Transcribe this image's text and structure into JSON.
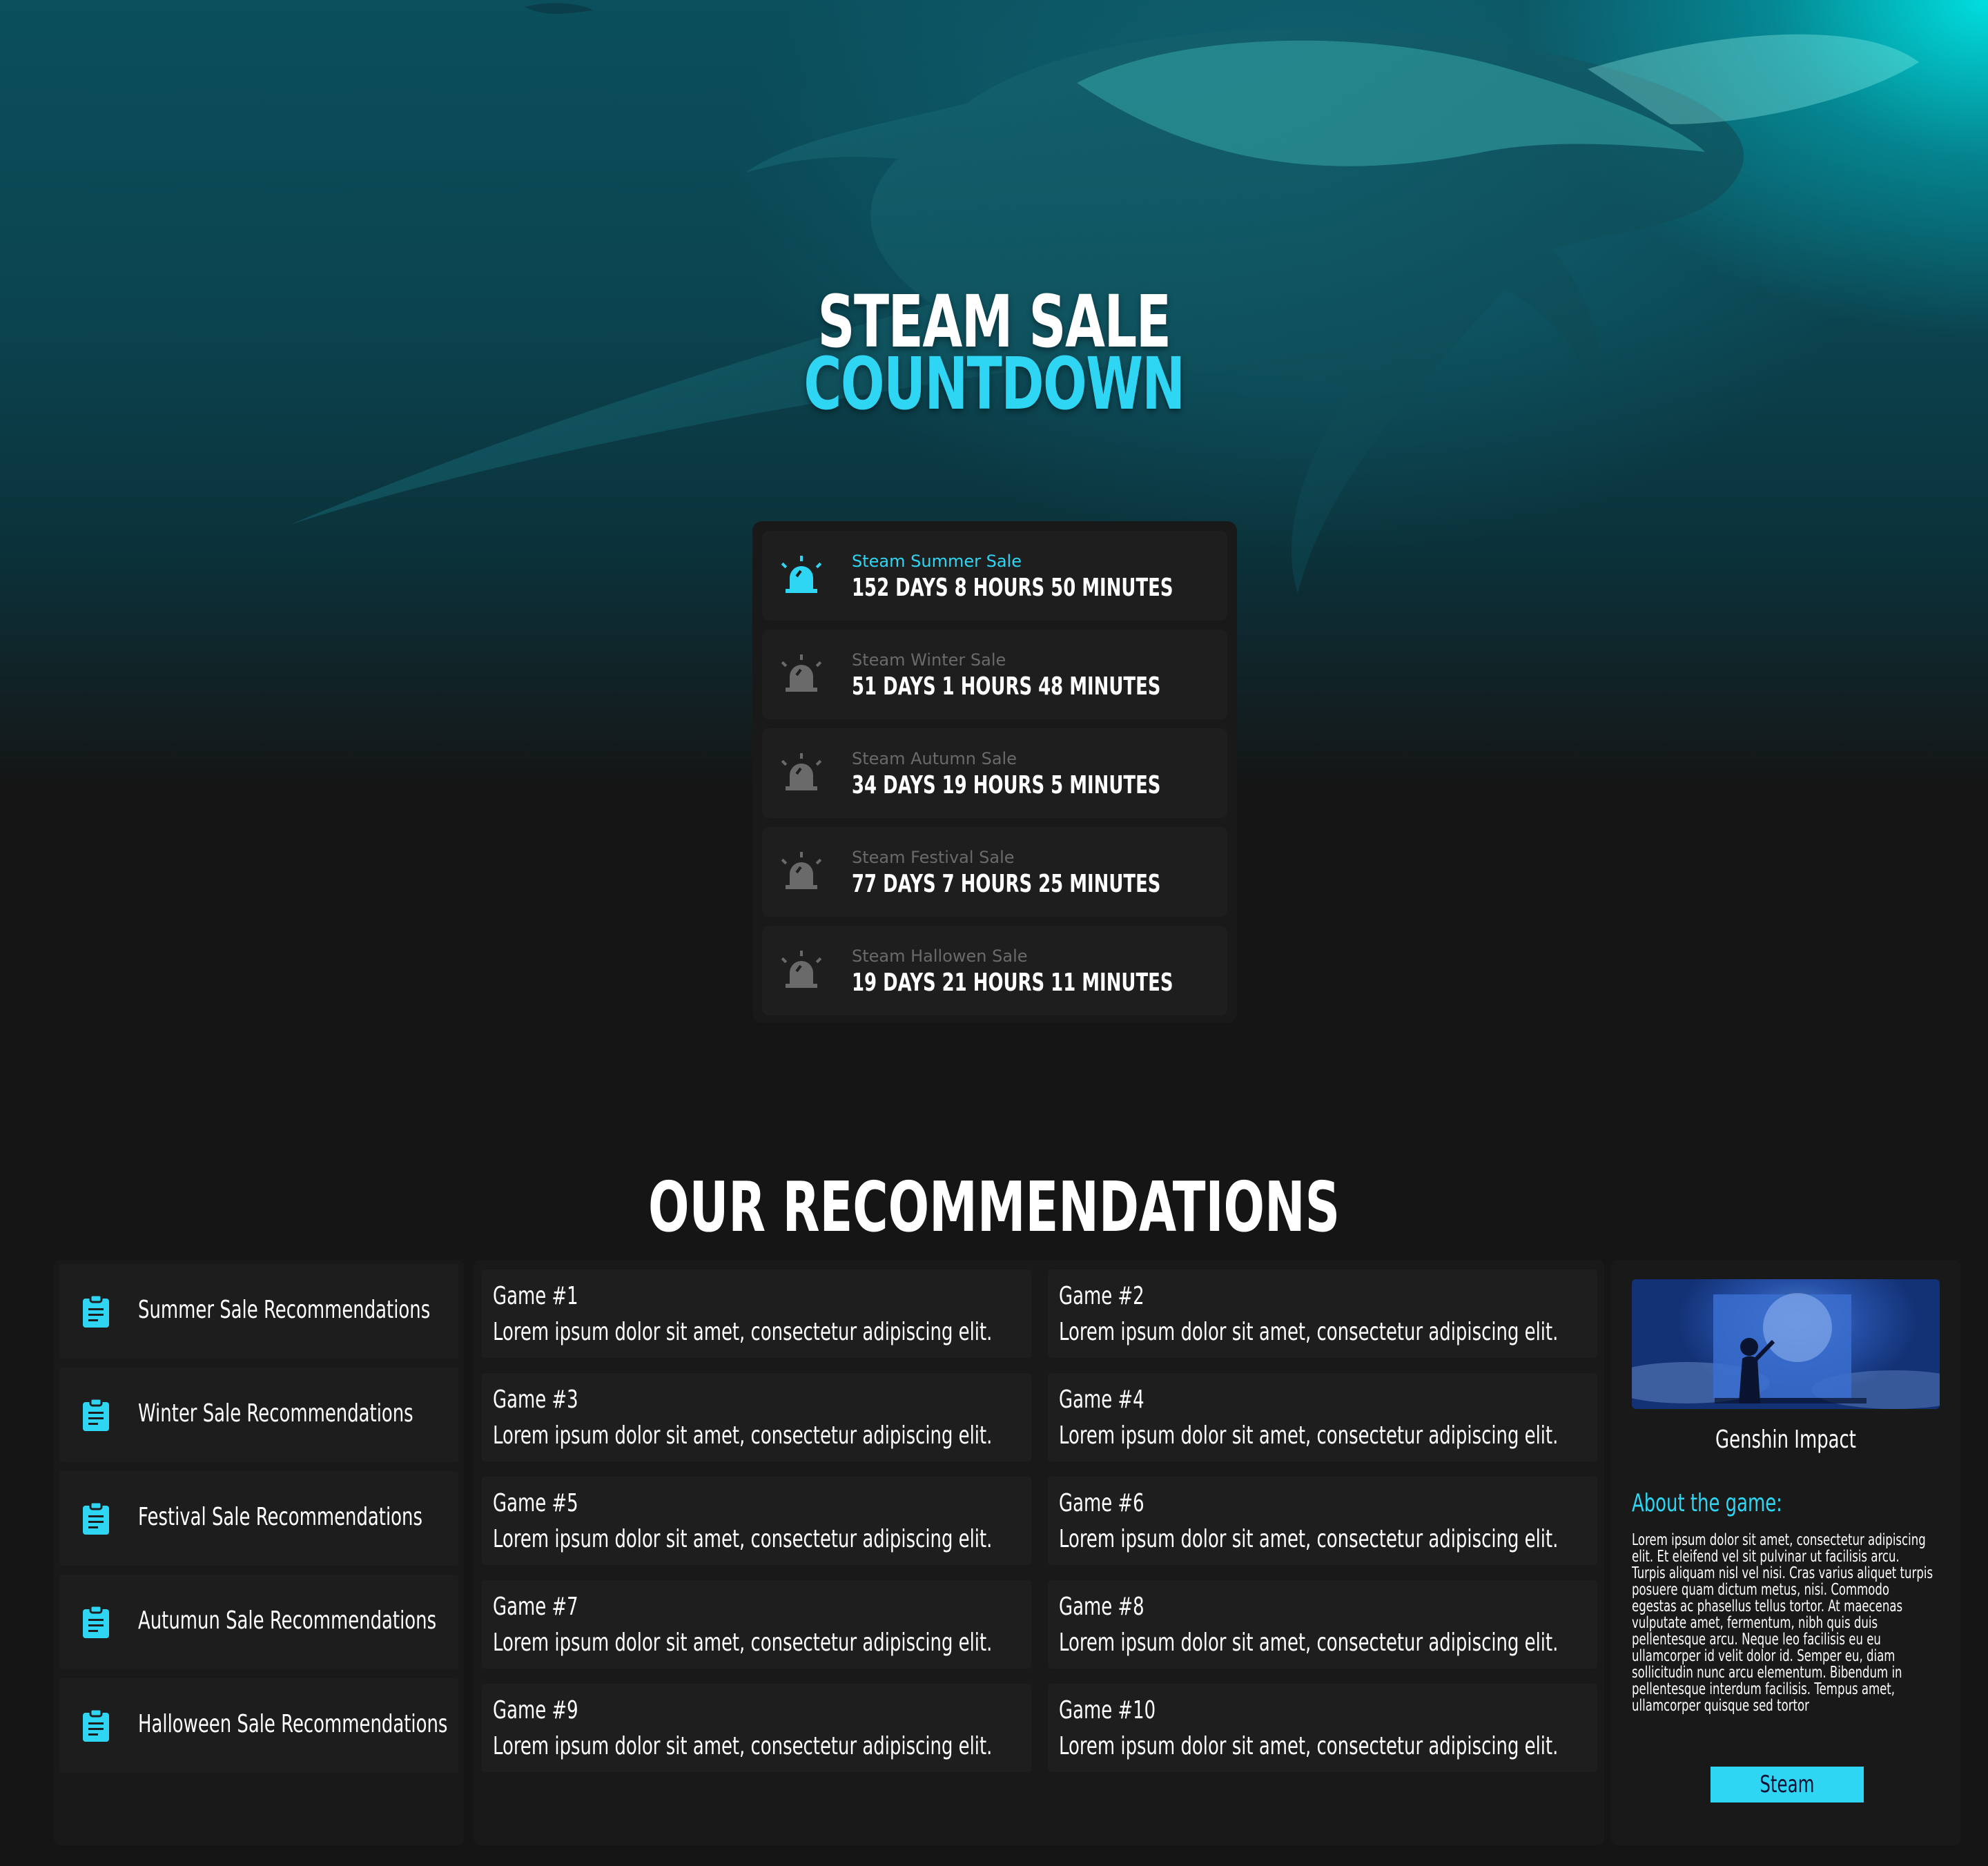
{
  "hero": {
    "title_line1": "STEAM SALE",
    "title_line2": "COUNTDOWN"
  },
  "countdowns": [
    {
      "label": "Steam Summer Sale",
      "value": "152 DAYS 8 HOURS 50 MINUTES",
      "active": true,
      "icon": "alarm-icon"
    },
    {
      "label": "Steam Winter Sale",
      "value": "51 DAYS 1 HOURS 48 MINUTES",
      "active": false,
      "icon": "alarm-icon"
    },
    {
      "label": "Steam Autumn Sale",
      "value": "34 DAYS 19 HOURS 5 MINUTES",
      "active": false,
      "icon": "alarm-icon"
    },
    {
      "label": "Steam Festival Sale",
      "value": "77 DAYS 7 HOURS 25 MINUTES",
      "active": false,
      "icon": "alarm-icon"
    },
    {
      "label": "Steam Hallowen Sale",
      "value": "19 DAYS 21 HOURS 11 MINUTES",
      "active": false,
      "icon": "alarm-icon"
    }
  ],
  "recommendations": {
    "title": "OUR RECOMMENDATIONS",
    "categories": [
      {
        "label": "Summer Sale Recommendations",
        "icon": "clipboard-icon"
      },
      {
        "label": "Winter Sale Recommendations",
        "icon": "clipboard-icon"
      },
      {
        "label": "Festival Sale Recommendations",
        "icon": "clipboard-icon"
      },
      {
        "label": "Autumun Sale Recommendations",
        "icon": "clipboard-icon"
      },
      {
        "label": "Halloween Sale Recommendations",
        "icon": "clipboard-icon"
      }
    ],
    "games": [
      {
        "title": "Game #1",
        "desc": "Lorem ipsum dolor sit amet, consectetur adipiscing elit."
      },
      {
        "title": "Game #2",
        "desc": "Lorem ipsum dolor sit amet, consectetur adipiscing elit."
      },
      {
        "title": "Game #3",
        "desc": "Lorem ipsum dolor sit amet, consectetur adipiscing elit."
      },
      {
        "title": "Game #4",
        "desc": "Lorem ipsum dolor sit amet, consectetur adipiscing elit."
      },
      {
        "title": "Game #5",
        "desc": "Lorem ipsum dolor sit amet, consectetur adipiscing elit."
      },
      {
        "title": "Game #6",
        "desc": "Lorem ipsum dolor sit amet, consectetur adipiscing elit."
      },
      {
        "title": "Game #7",
        "desc": "Lorem ipsum dolor sit amet, consectetur adipiscing elit."
      },
      {
        "title": "Game #8",
        "desc": "Lorem ipsum dolor sit amet, consectetur adipiscing elit."
      },
      {
        "title": "Game #9",
        "desc": "Lorem ipsum dolor sit amet, consectetur adipiscing elit."
      },
      {
        "title": "Game #10",
        "desc": "Lorem ipsum dolor sit amet, consectetur adipiscing elit."
      }
    ],
    "featured": {
      "name": "Genshin Impact",
      "about_label": "About the game:",
      "description": "Lorem ipsum dolor sit amet, consectetur adipiscing elit. Et eleifend vel sit pulvinar ut facilisis arcu. Turpis aliquam nisl vel nisi. Cras varius aliquet turpis posuere quam dictum metus, nisi. Commodo egestas ac phasellus tellus tortor. At maecenas vulputate amet, fermentum, nibh quis duis pellentesque arcu. Neque leo facilisis eu eu ullamcorper id velit dolor id. Semper eu, diam sollicitudin nunc arcu elementum. Bibendum in pellentesque interdum facilisis. Tempus amet, ullamcorper quisque sed tortor",
      "button_label": "Steam"
    }
  },
  "colors": {
    "accent": "#2fd6f4",
    "background": "#151515",
    "panel": "#191919",
    "card": "#1e1e1e",
    "inactive_icon": "#6a6a6a"
  }
}
